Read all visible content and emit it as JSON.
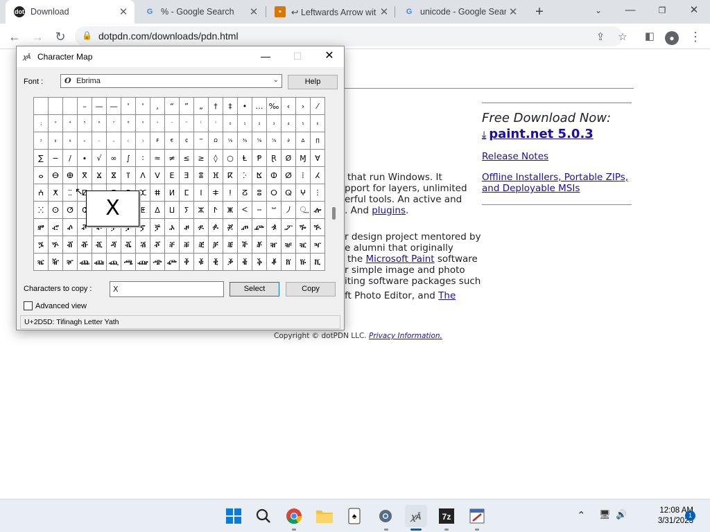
{
  "browser": {
    "tabs": [
      {
        "title": "Download",
        "favicon": "dpdn-favicon",
        "active": true
      },
      {
        "title": "% - Google Search",
        "favicon": "google-favicon",
        "active": false
      },
      {
        "title": "↩ Leftwards Arrow wit",
        "favicon": "bookmark-favicon",
        "active": false
      },
      {
        "title": "unicode - Google Sear",
        "favicon": "google-favicon",
        "active": false
      }
    ],
    "url": "dotpdn.com/downloads/pdn.html"
  },
  "page": {
    "free_title": "Free Download Now:",
    "download_link": "paint.net 5.0.3",
    "release_notes": "Release Notes",
    "offline_line1": "Offline Installers, Portable ZIPs,",
    "offline_line2": "and Deployable MSIs",
    "p1_l1": "that run Windows. It",
    "p1_l2": "pport for layers, unlimited",
    "p1_l3": "erful tools. An active and",
    "p1_l4_pre": ". And ",
    "p1_l4_link": "plugins",
    "p1_l4_post": ".",
    "p2_l1": "r design project mentored by",
    "p2_l2": "e alumni that originally",
    "p2_l3_pre": "the ",
    "p2_l3_link": "Microsoft Paint",
    "p2_l3_post": " software",
    "p2_l4": "r simple image and photo",
    "p2_l5": "iting software packages such",
    "p2_l6_pre": "ft Photo Editor, and ",
    "p2_l6_link": "The",
    "copyright_pre": "Copyright © dotPDN LLC. ",
    "copyright_link": "Privacy Information."
  },
  "charmap": {
    "title": "Character Map",
    "font_label": "Font :",
    "font_value": "Ebrima",
    "help": "Help",
    "copy_label": "Characters to copy :",
    "copy_value": "ⵝ",
    "select": "Select",
    "copy": "Copy",
    "advanced": "Advanced view",
    "status": "U+2D5D: Tifinagh Letter Yath",
    "zoom_char": "X",
    "grid": [
      [
        "",
        "",
        "",
        "–",
        "—",
        "—",
        "'",
        "'",
        "‚",
        "“",
        "”",
        "„",
        "†",
        "‡",
        "•",
        "…",
        "‰",
        "‹",
        "›",
        "⁄"
      ],
      [
        "⁏",
        "⁰",
        "⁴",
        "⁵",
        "⁶",
        "⁷",
        "⁸",
        "⁹",
        "⁺",
        "⁻",
        "⁼",
        "⁽",
        "⁾",
        "₀",
        "₁",
        "₂",
        "₃",
        "₄",
        "₅",
        "₆"
      ],
      [
        "₇",
        "₈",
        "₉",
        "₊",
        "₋",
        "₌",
        "₍",
        "₎",
        "₣",
        "€",
        "₵",
        "™",
        "Ω",
        "⅛",
        "⅜",
        "⅝",
        "⅞",
        "∂",
        "∆",
        "∏"
      ],
      [
        "∑",
        "−",
        "∕",
        "∙",
        "√",
        "∞",
        "∫",
        "∶",
        "≈",
        "≠",
        "≤",
        "≥",
        "◊",
        "○",
        "Ⱡ",
        "Ᵽ",
        "Ɽ",
        "Ø",
        "Ɱ",
        "Ɐ"
      ],
      [
        "ⴰ",
        "ⴱ",
        "ⴲ",
        "ⴳ",
        "ⴴ",
        "ⴵ",
        "ⴶ",
        "ⴷ",
        "ⴸ",
        "ⴹ",
        "ⴺ",
        "ⴻ",
        "ⴼ",
        "ⴽ",
        "ⴾ",
        "ⴿ",
        "ⵀ",
        "ⵁ",
        "ⵂ",
        "ⵃ"
      ],
      [
        "ⵄ",
        "ⵅ",
        "ⵆ",
        "ⵇ",
        "ⵈ",
        "ⵉ",
        "ⵊ",
        "ⵋ",
        "ⵌ",
        "ⵍ",
        "ⵎ",
        "ⵏ",
        "ⵐ",
        "ⵑ",
        "ⵒ",
        "ⵓ",
        "ⵔ",
        "ⵕ",
        "ⵖ",
        "ⵗ"
      ],
      [
        "ⵘ",
        "ⵙ",
        "ⵚ",
        "ⵛ",
        "ⵜ",
        "ⵝ",
        "ⵞ",
        "ⵟ",
        "ⵠ",
        "ⵡ",
        "ⵢ",
        "ⵣ",
        "ⵤ",
        "ⵥ",
        "ⵦ",
        "ⵧ",
        "ⵯ",
        "⵰",
        "⵿",
        "ⶀ"
      ],
      [
        "ⶁ",
        "ⶂ",
        "ⶃ",
        "ⶄ",
        "ⶅ",
        "ⶆ",
        "ⶇ",
        "ⶈ",
        "ⶉ",
        "ⶊ",
        "ⶋ",
        "ⶌ",
        "ⶍ",
        "ⶎ",
        "ⶏ",
        "ⶐ",
        "ⶑ",
        "ⶒ",
        "ⶓ",
        "ⶔ"
      ],
      [
        "ⶕ",
        "ⶖ",
        "ⶠ",
        "ⶡ",
        "ⶢ",
        "ⶣ",
        "ⶤ",
        "ⶥ",
        "ⶦ",
        "ⶨ",
        "ⶩ",
        "ⶪ",
        "ⶫ",
        "ⶬ",
        "ⶭ",
        "ⶮ",
        "ⶰ",
        "ⶱ",
        "ⶲ",
        "ⶳ"
      ],
      [
        "ⶴ",
        "ⶵ",
        "ⶶ",
        "ⶸ",
        "ⶹ",
        "ⶺ",
        "ⶻ",
        "ⶼ",
        "ⶽ",
        "ⶾ",
        "ⷀ",
        "ⷁ",
        "ⷂ",
        "ⷃ",
        "ⷄ",
        "ⷅ",
        "ⷆ",
        "ⷈ",
        "ⷉ",
        "ⷊ"
      ]
    ],
    "small_rows": [
      1,
      2
    ]
  },
  "taskbar": {
    "time": "12:08 AM",
    "date": "3/31/2023",
    "notifications": "1"
  }
}
